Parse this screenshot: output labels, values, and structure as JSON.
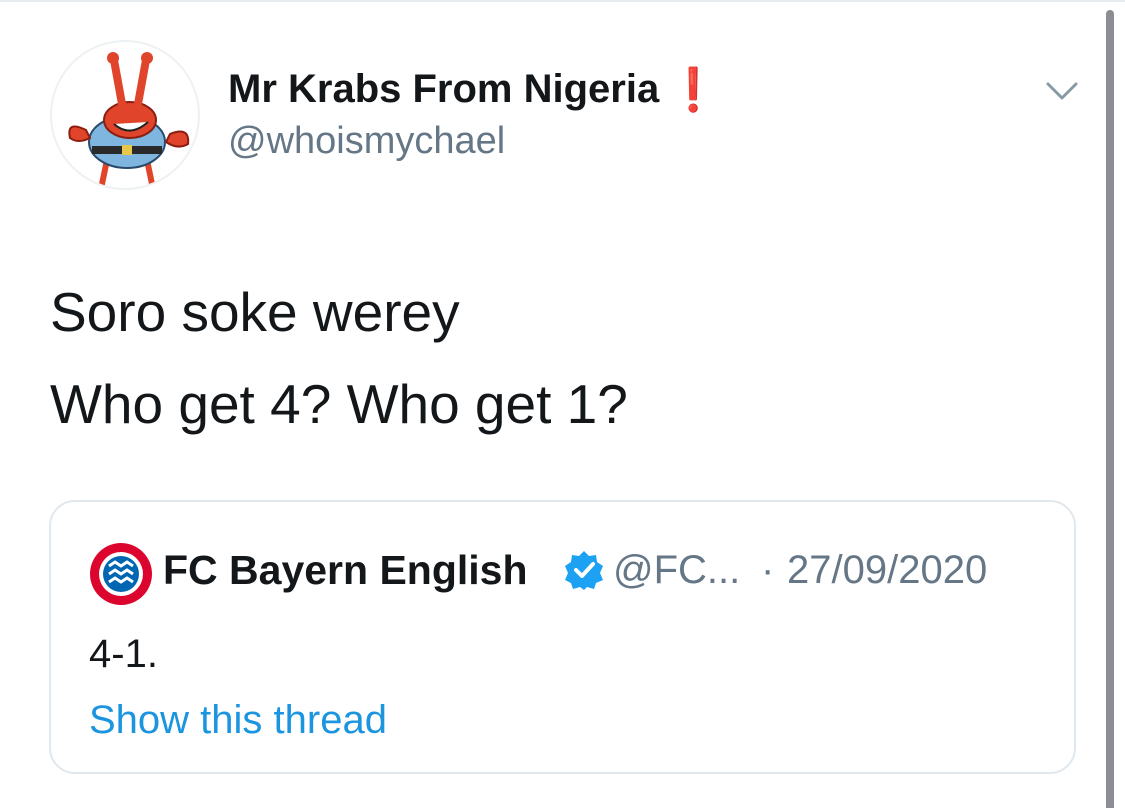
{
  "tweet": {
    "author_name": "Mr Krabs From Nigeria",
    "author_badge": "❗",
    "author_handle": "@whoismychael",
    "text_lines": [
      "Soro soke werey",
      "Who get 4? Who get 1?"
    ]
  },
  "quoted_tweet": {
    "author_name": "FC Bayern English",
    "author_handle": "@FC...",
    "separator": "·",
    "date": "27/09/2020",
    "text": "4-1.",
    "show_thread_label": "Show this thread"
  },
  "icons": {
    "avatar": "mr-krabs-avatar",
    "menu": "chevron-down-icon",
    "quoted_avatar": "fc-bayern-logo",
    "verified": "verified-badge-icon"
  },
  "colors": {
    "text_primary": "#14171a",
    "text_secondary": "#657786",
    "link": "#1b95e0",
    "verified": "#1da1f2",
    "badge": "#e0245e",
    "card_border": "#e1e8ed",
    "scrollbar": "#8a8d91"
  }
}
